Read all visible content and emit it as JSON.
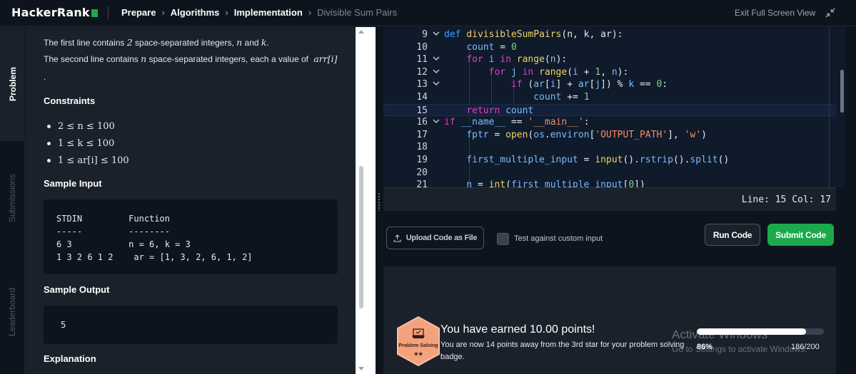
{
  "header": {
    "logo": "HackerRank",
    "breadcrumb": [
      "Prepare",
      "Algorithms",
      "Implementation",
      "Divisible Sum Pairs"
    ],
    "exit_fullscreen": "Exit Full Screen View"
  },
  "vtabs": [
    "Problem",
    "Submissions",
    "Leaderboard"
  ],
  "problem": {
    "line1_pre": "The first line contains",
    "line1_num": "2",
    "line1_mid": "space-separated integers,",
    "line1_n": "n",
    "line1_and": "and",
    "line1_k": "k",
    "line1_end": ".",
    "line2_pre": "The second line contains",
    "line2_n": "n",
    "line2_mid": "space-separated integers, each a value of",
    "line2_arr": "arr[i]",
    "line2_end": ".",
    "constraints_title": "Constraints",
    "constraints": [
      "2 ≤ n ≤ 100",
      "1 ≤ k ≤ 100",
      "1 ≤ ar[i] ≤ 100"
    ],
    "sample_input_title": "Sample Input",
    "sample_input": "STDIN         Function\n-----         --------\n6 3           n = 6, k = 3\n1 3 2 6 1 2    ar = [1, 3, 2, 6, 1, 2]",
    "sample_output_title": "Sample Output",
    "sample_output": "5",
    "explanation_title": "Explanation"
  },
  "editor": {
    "lines": [
      {
        "n": "9",
        "fold": true,
        "html": "<span class=\"kw2\">def</span> <span class=\"fn\">divisibleSumPairs</span>(n, k, ar):"
      },
      {
        "n": "10",
        "fold": false,
        "html": "    <span class=\"id\">count</span> = <span class=\"num\">0</span>"
      },
      {
        "n": "11",
        "fold": true,
        "html": "    <span class=\"kw\">for</span> <span class=\"id\">i</span> <span class=\"kw\">in</span> <span class=\"fn\">range</span>(<span class=\"id\">n</span>):"
      },
      {
        "n": "12",
        "fold": true,
        "html": "        <span class=\"kw\">for</span> <span class=\"id\">j</span> <span class=\"kw\">in</span> <span class=\"fn\">range</span>(<span class=\"id\">i</span> + <span class=\"num\">1</span>, <span class=\"id\">n</span>):"
      },
      {
        "n": "13",
        "fold": true,
        "html": "            <span class=\"kw\">if</span> (<span class=\"id\">ar</span>[<span class=\"id\">i</span>] + <span class=\"id\">ar</span>[<span class=\"id\">j</span>]) % <span class=\"id\">k</span> == <span class=\"num\">0</span>:"
      },
      {
        "n": "14",
        "fold": false,
        "html": "                <span class=\"id\">count</span> += <span class=\"num\">1</span>"
      },
      {
        "n": "15",
        "fold": false,
        "html": "    <span class=\"kw\">return</span> <span class=\"id\">count</span>"
      },
      {
        "n": "16",
        "fold": true,
        "html": "<span class=\"kw\">if</span> <span class=\"id\">__name__</span> == <span class=\"str\">'__main__'</span>:"
      },
      {
        "n": "17",
        "fold": false,
        "html": "    <span class=\"id\">fptr</span> = <span class=\"fn\">open</span>(<span class=\"id\">os</span>.<span class=\"id\">environ</span>[<span class=\"str\">'OUTPUT_PATH'</span>], <span class=\"str\">'w'</span>)"
      },
      {
        "n": "18",
        "fold": false,
        "html": ""
      },
      {
        "n": "19",
        "fold": false,
        "html": "    <span class=\"id\">first_multiple_input</span> = <span class=\"fn\">input</span>().<span class=\"id\">rstrip</span>().<span class=\"id\">split</span>()"
      },
      {
        "n": "20",
        "fold": false,
        "html": ""
      },
      {
        "n": "21",
        "fold": false,
        "html": "    <span class=\"id\">n</span> = <span class=\"fn\">int</span>(<span class=\"id\">first_multiple_input</span>[<span class=\"num\">0</span>])"
      }
    ],
    "active_line_index": 6,
    "status": "Line: 15 Col: 17"
  },
  "actions": {
    "upload": "Upload Code as File",
    "custom_input": "Test against custom input",
    "run": "Run Code",
    "submit": "Submit Code"
  },
  "result": {
    "badge_label": "Problem Solving",
    "badge_stars": "★★",
    "title": "You have earned 10.00 points!",
    "subtitle": "You are now 14 points away from the 3rd star for your problem solving badge.",
    "progress_fraction": 0.86,
    "progress_pct": "86%",
    "progress_count": "186/200"
  },
  "watermark": {
    "line1": "Activate Windows",
    "line2": "Go to Settings to activate Windows."
  },
  "colors": {
    "accent_green": "#1ba94c",
    "bg_dark": "#0e141e",
    "panel": "#1a212b",
    "badge_orange": "#f4a27d"
  }
}
